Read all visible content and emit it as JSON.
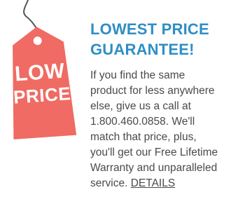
{
  "tag": {
    "icon": "price-tag-icon",
    "line1": "LOW",
    "line2": "PRICE",
    "color": "#f06b63"
  },
  "headline": {
    "line1": "LOWEST PRICE",
    "line2": "GUARANTEE!",
    "color": "#2f8ec4"
  },
  "body": {
    "lines": [
      "If you find the same",
      "product for less anywhere",
      "else, give us a call at",
      "1.800.460.0858. We'll",
      "match that price, plus,",
      "you'll get our Free Lifetime",
      "Warranty and unparalleled"
    ],
    "last_line_prefix": "service.",
    "details_link": "DETAILS"
  }
}
